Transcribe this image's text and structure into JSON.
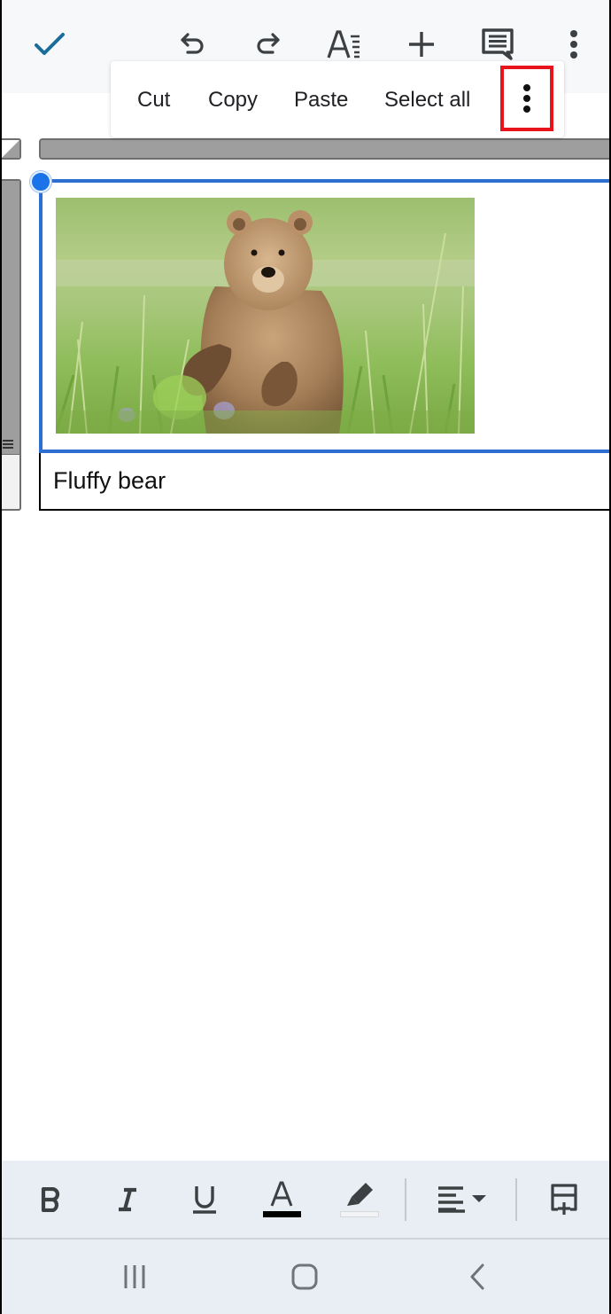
{
  "topbar": {
    "icons": {
      "done": "check-icon",
      "undo": "undo-icon",
      "redo": "redo-icon",
      "text_format": "text-format-icon",
      "insert": "plus-icon",
      "comment": "comment-icon",
      "more": "more-vert-icon"
    },
    "accent_color": "#1a6c9a"
  },
  "context_menu": {
    "items": [
      {
        "label": "Cut"
      },
      {
        "label": "Copy"
      },
      {
        "label": "Paste"
      },
      {
        "label": "Select all"
      }
    ],
    "more_icon": "more-vert-icon",
    "highlight_color": "#e8141b"
  },
  "document": {
    "image": {
      "alt": "Bear cub standing in grass",
      "selection_color": "#2d6fd1"
    },
    "caption": "Fluffy bear"
  },
  "format_toolbar": {
    "buttons": [
      {
        "name": "bold",
        "icon": "bold-icon"
      },
      {
        "name": "italic",
        "icon": "italic-icon"
      },
      {
        "name": "underline",
        "icon": "underline-icon"
      },
      {
        "name": "text-color",
        "icon": "text-color-icon",
        "color": "#000000"
      },
      {
        "name": "highlight",
        "icon": "highlighter-icon"
      },
      {
        "name": "align",
        "icon": "align-left-icon"
      },
      {
        "name": "insert-table-row",
        "icon": "table-insert-icon"
      }
    ]
  },
  "nav_bar": {
    "recents": "recents-icon",
    "home": "home-icon",
    "back": "back-icon"
  }
}
